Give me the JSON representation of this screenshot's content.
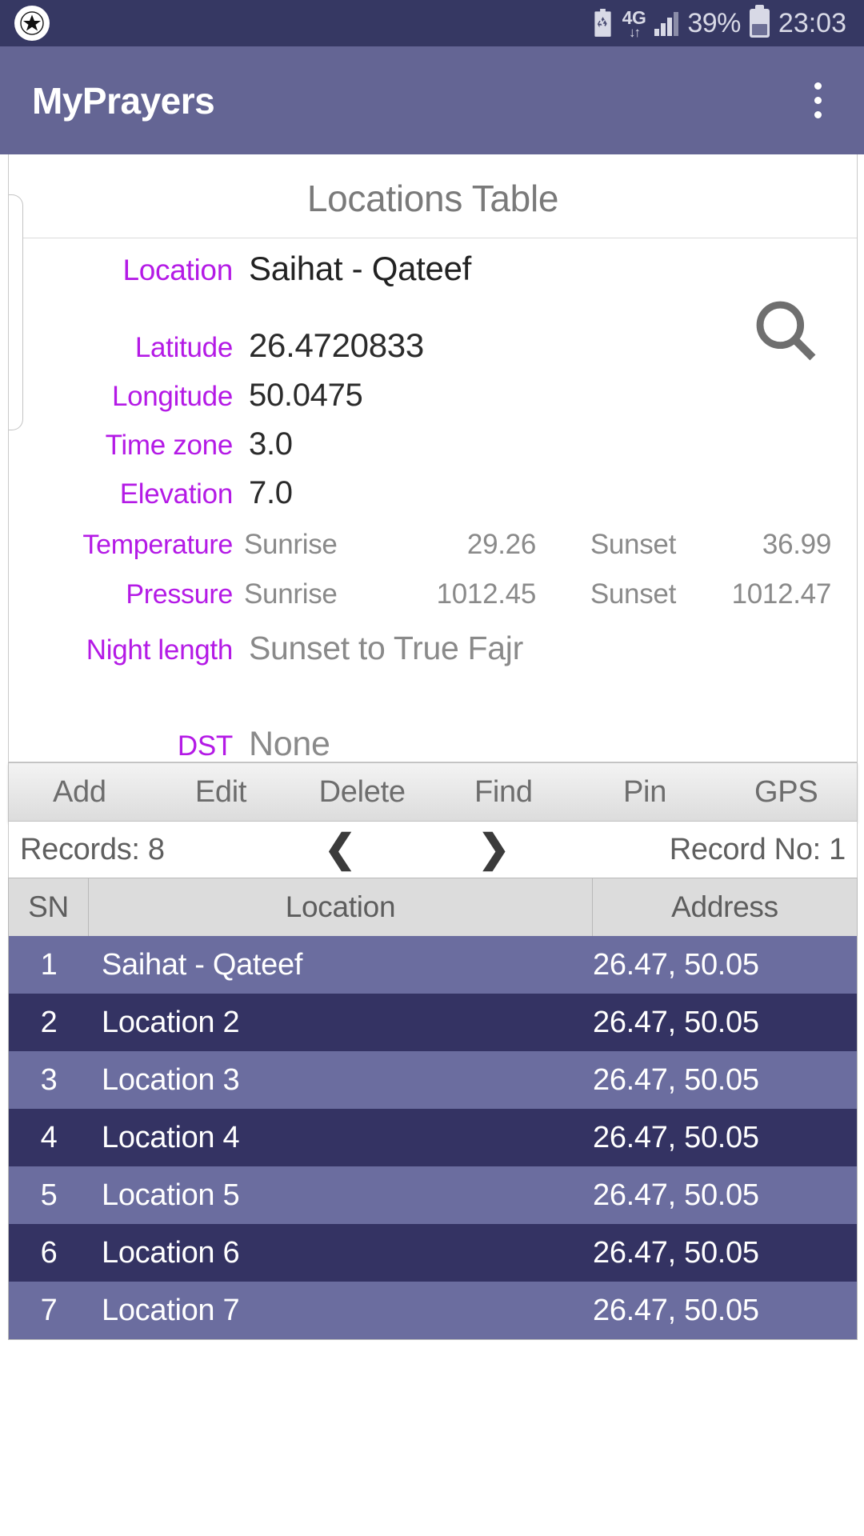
{
  "status_bar": {
    "notification_icon": "star-badge-icon",
    "battery_saver_icon": "battery-saver-icon",
    "network_type": "4G",
    "data_arrows": "↓↑",
    "signal_icon": "signal-bars-icon",
    "battery_percent": "39%",
    "battery_icon": "battery-icon",
    "clock": "23:03",
    "bg_color": "#363863"
  },
  "app_bar": {
    "title": "MyPrayers",
    "overflow_icon": "overflow-menu-icon",
    "bg_color": "#646594"
  },
  "detail_card": {
    "title": "Locations Table",
    "search_icon": "search-icon",
    "label_color": "#b41ae6",
    "fields": {
      "location": {
        "label": "Location",
        "value": "Saihat - Qateef"
      },
      "latitude": {
        "label": "Latitude",
        "value": "26.4720833"
      },
      "longitude": {
        "label": "Longitude",
        "value": "50.0475"
      },
      "time_zone": {
        "label": "Time zone",
        "value": "3.0"
      },
      "elevation": {
        "label": "Elevation",
        "value": "7.0"
      },
      "temperature": {
        "label": "Temperature",
        "sunrise_label": "Sunrise",
        "sunrise_value": "29.26",
        "sunset_label": "Sunset",
        "sunset_value": "36.99"
      },
      "pressure": {
        "label": "Pressure",
        "sunrise_label": "Sunrise",
        "sunrise_value": "1012.45",
        "sunset_label": "Sunset",
        "sunset_value": "1012.47"
      },
      "night_length": {
        "label": "Night length",
        "value": "Sunset to True Fajr"
      },
      "dst": {
        "label": "DST",
        "value": "None"
      }
    }
  },
  "action_bar": {
    "buttons": [
      {
        "label": "Add"
      },
      {
        "label": "Edit"
      },
      {
        "label": "Delete"
      },
      {
        "label": "Find"
      },
      {
        "label": "Pin"
      },
      {
        "label": "GPS"
      }
    ]
  },
  "records_bar": {
    "records_text": "Records: 8",
    "prev_icon": "chevron-left-icon",
    "prev_glyph": "❮",
    "next_icon": "chevron-right-icon",
    "next_glyph": "❯",
    "record_no_text": "Record No: 1"
  },
  "locations_table": {
    "columns": [
      "SN",
      "Location",
      "Address"
    ],
    "row_color_odd": "#6b6d9f",
    "row_color_even": "#343363",
    "rows": [
      {
        "sn": "1",
        "location": "Saihat - Qateef",
        "address": "26.47, 50.05"
      },
      {
        "sn": "2",
        "location": "Location 2",
        "address": "26.47, 50.05"
      },
      {
        "sn": "3",
        "location": "Location 3",
        "address": "26.47, 50.05"
      },
      {
        "sn": "4",
        "location": "Location 4",
        "address": "26.47, 50.05"
      },
      {
        "sn": "5",
        "location": "Location 5",
        "address": "26.47, 50.05"
      },
      {
        "sn": "6",
        "location": "Location 6",
        "address": "26.47, 50.05"
      },
      {
        "sn": "7",
        "location": "Location 7",
        "address": "26.47, 50.05"
      }
    ]
  }
}
